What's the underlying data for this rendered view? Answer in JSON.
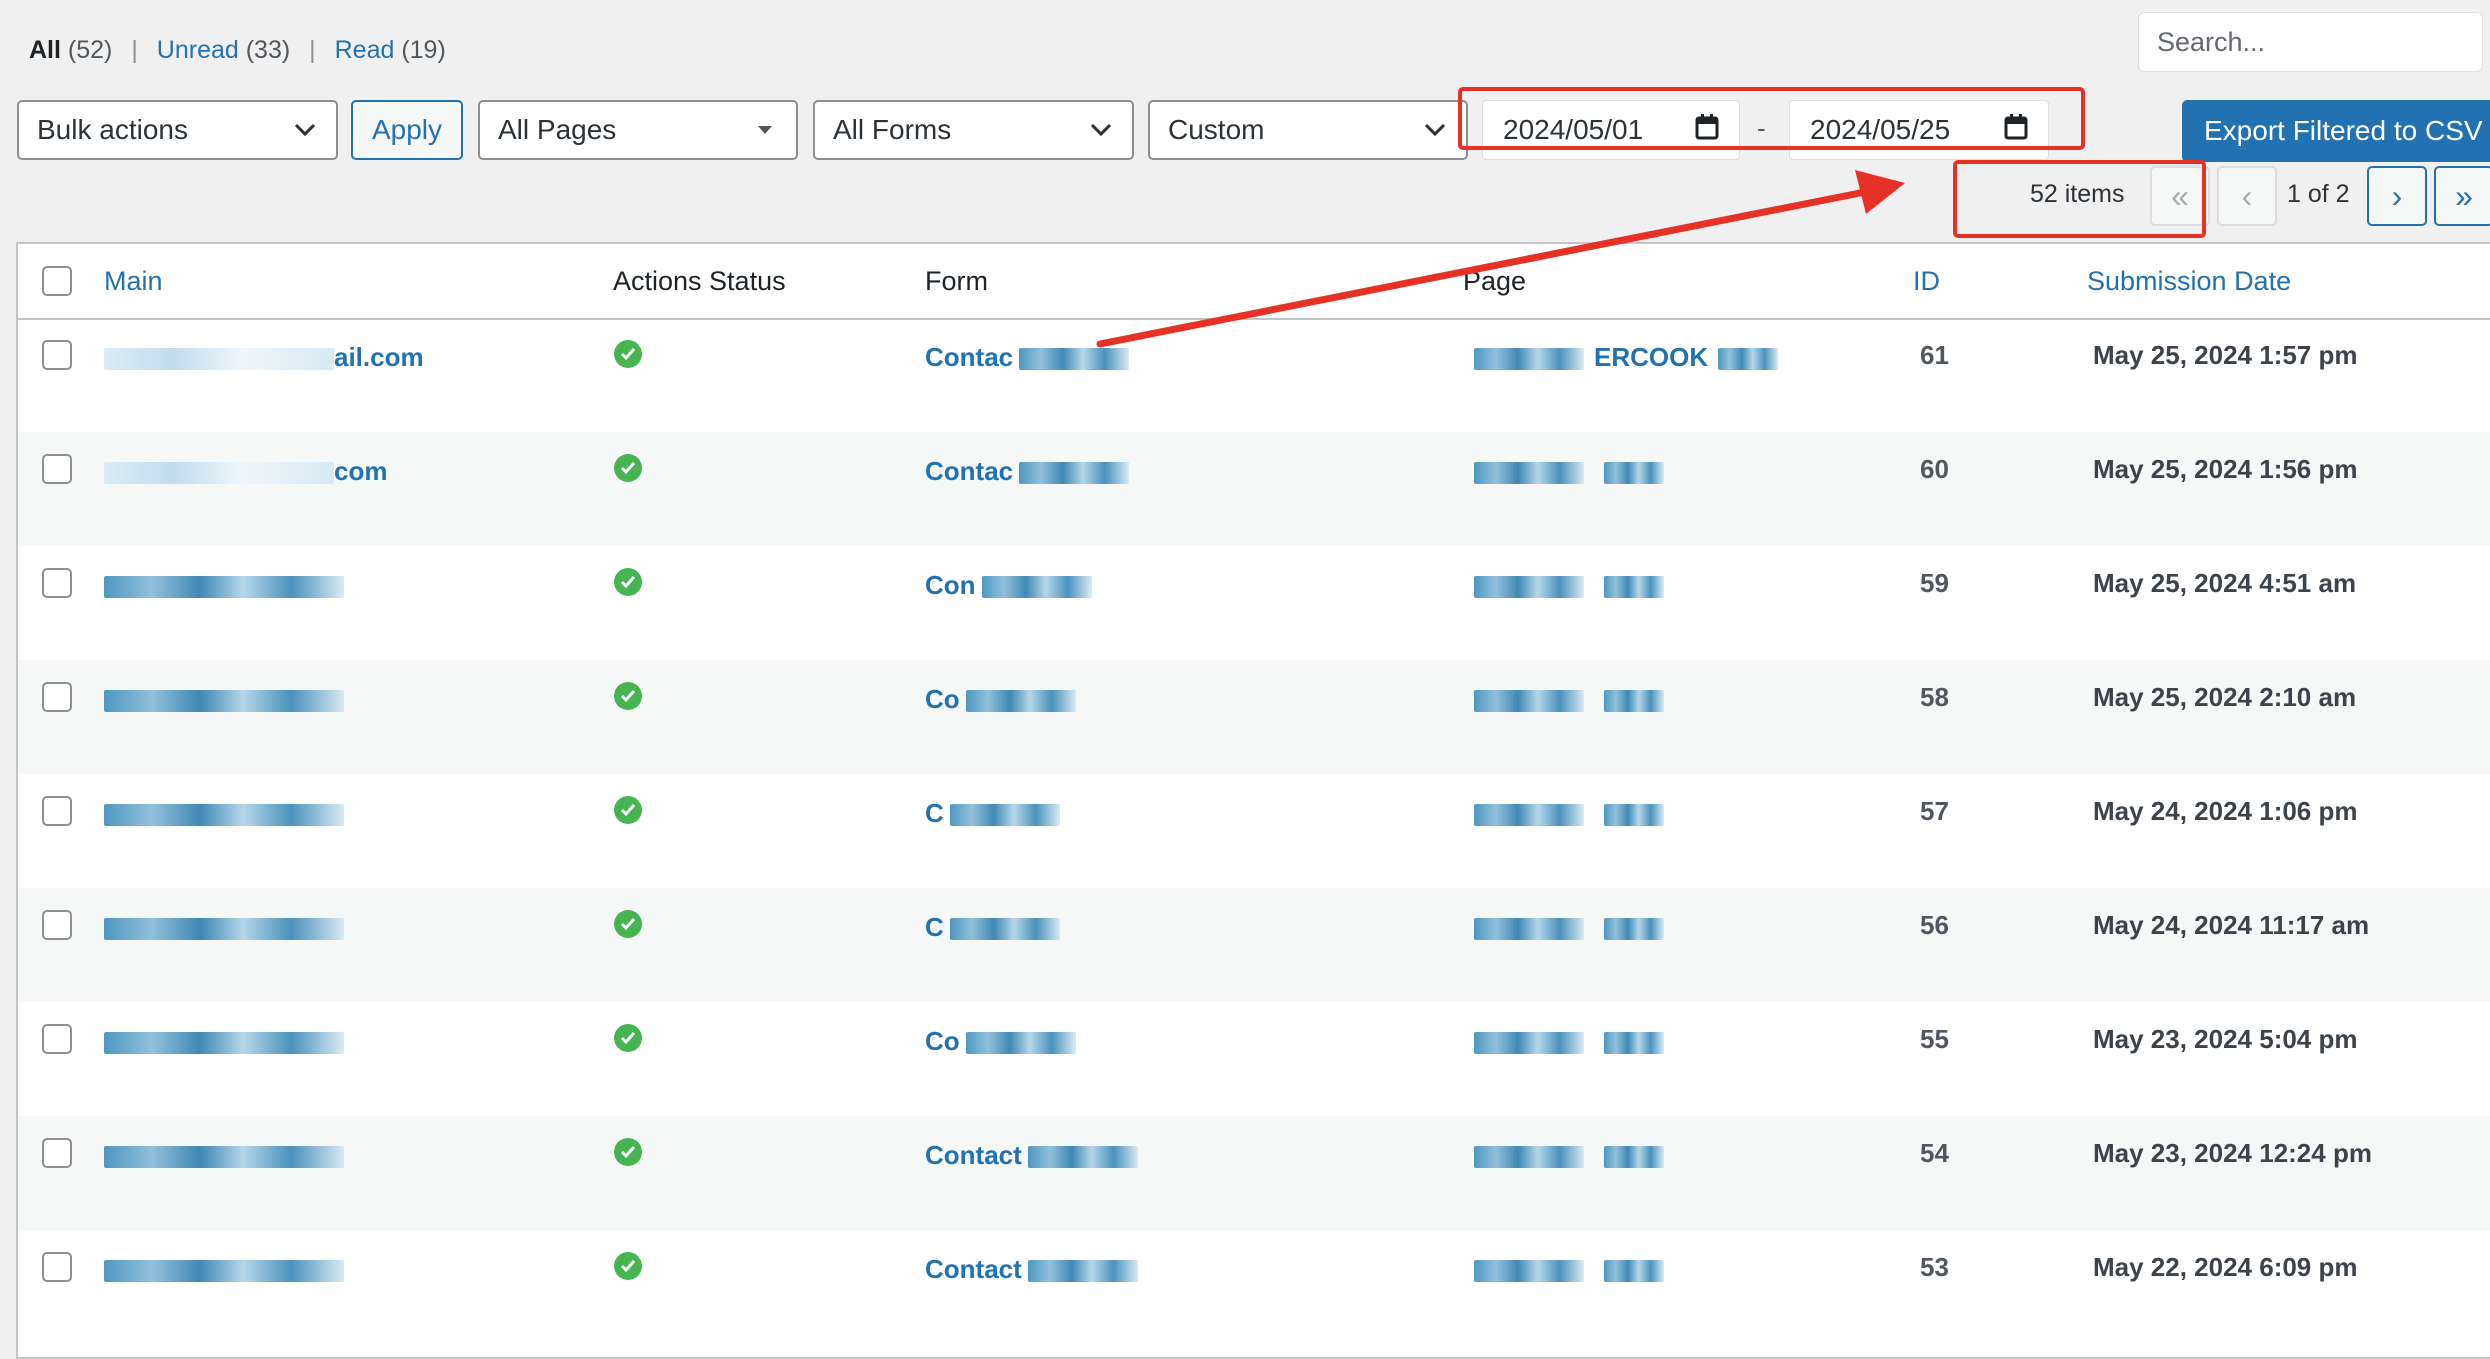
{
  "status_filters": {
    "all": {
      "label": "All",
      "count": "(52)"
    },
    "unread": {
      "label": "Unread",
      "count": "(33)"
    },
    "read": {
      "label": "Read",
      "count": "(19)"
    },
    "separator": "|"
  },
  "search": {
    "placeholder": "Search..."
  },
  "toolbar": {
    "bulk_actions": "Bulk actions",
    "apply": "Apply",
    "pages_filter": "All Pages",
    "forms_filter": "All Forms",
    "date_range": "Custom",
    "date_from": "2024/05/01",
    "date_to": "2024/05/25",
    "date_separator": "-",
    "export": "Export Filtered to CSV"
  },
  "pagination": {
    "items": "52 items",
    "first": "«",
    "prev": "‹",
    "page_info": "1 of 2",
    "next": "›",
    "last": "»"
  },
  "table": {
    "columns": {
      "main": "Main",
      "actions_status": "Actions Status",
      "form": "Form",
      "page": "Page",
      "id": "ID",
      "submission_date": "Submission Date"
    },
    "rows": [
      {
        "main": "ail.com",
        "form": "Contac",
        "page": "ERCOOK",
        "id": "61",
        "date": "May 25, 2024 1:57 pm"
      },
      {
        "main": "com",
        "form": "Contac",
        "page": "",
        "id": "60",
        "date": "May 25, 2024 1:56 pm"
      },
      {
        "main": "",
        "form": "Con",
        "page": "",
        "id": "59",
        "date": "May 25, 2024 4:51 am"
      },
      {
        "main": "",
        "form": "Co",
        "page": "",
        "id": "58",
        "date": "May 25, 2024 2:10 am"
      },
      {
        "main": "",
        "form": "C",
        "page": "",
        "id": "57",
        "date": "May 24, 2024 1:06 pm"
      },
      {
        "main": "",
        "form": "C",
        "page": "",
        "id": "56",
        "date": "May 24, 2024 11:17 am"
      },
      {
        "main": "",
        "form": "Co",
        "page": "",
        "id": "55",
        "date": "May 23, 2024 5:04 pm"
      },
      {
        "main": "",
        "form": "Contact",
        "page": "",
        "id": "54",
        "date": "May 23, 2024 12:24 pm"
      },
      {
        "main": "",
        "form": "Contact",
        "page": "",
        "id": "53",
        "date": "May 22, 2024 6:09 pm"
      }
    ]
  },
  "colors": {
    "link": "#2271b1",
    "success": "#46b450",
    "annotation": "#e53126"
  },
  "icons": [
    "chevron-down-icon",
    "calendar-icon",
    "check-circle-icon",
    "arrow-annotation"
  ]
}
